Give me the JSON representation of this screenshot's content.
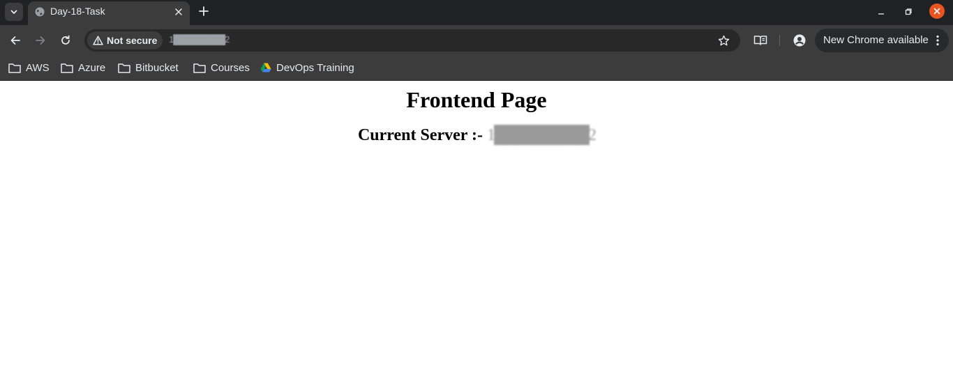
{
  "browser": {
    "tab": {
      "title": "Day-18-Task",
      "favicon": "globe-icon"
    },
    "address_bar": {
      "security_label": "Not secure",
      "url": "1█████████2"
    },
    "update_button": {
      "label": "New Chrome available"
    },
    "window_controls": {
      "close_color": "#e95420"
    },
    "bookmarks": [
      {
        "label": "AWS",
        "icon": "folder-icon"
      },
      {
        "label": "Azure",
        "icon": "folder-icon"
      },
      {
        "label": "Bitbucket",
        "icon": "folder-icon"
      },
      {
        "label": "Courses",
        "icon": "folder-icon"
      },
      {
        "label": "DevOps Training",
        "icon": "google-drive-icon"
      }
    ]
  },
  "page": {
    "heading": "Frontend Page",
    "server_label": "Current Server :-",
    "server_value": "1█████████2"
  }
}
